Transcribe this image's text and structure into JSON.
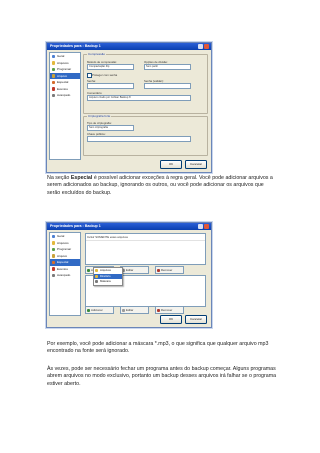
{
  "dialog1": {
    "title": "Propriedades para : Backup 1",
    "sidebar": [
      "Geral",
      "Arquivos",
      "Programar",
      "Arquivo comprimido",
      "Especial",
      "Eventos",
      "Avançado"
    ],
    "group_compress": "Compressão",
    "method_label": "Método de compressão:",
    "method_value": "Compactação Zip",
    "split_label": "Opções de divisão:",
    "split_value": "Sem partir",
    "protect_label": "Proteger com senha",
    "password_label": "Senha:",
    "password_confirm_label": "Senha (validar):",
    "comment_label": "Comentário:",
    "comment_value": "Arquivo criado por Cobian Backup 8",
    "group_crypto": "Criptografia forte",
    "crypto_type_label": "Tipo de criptografia:",
    "crypto_type_value": "Sem criptografia",
    "key_label": "Chave pública:",
    "ok": "OK",
    "cancel": "Cancelar"
  },
  "paragraph1_label": "Na seção ",
  "paragraph1_bold": "Especial",
  "paragraph1_rest": " é possível adicionar exceções à regra geral. Você pode adicionar arquivos a serem adicionados ao backup, ignorando os outros, ou você pode adicionar os arquivos que serão excluídos do backup.",
  "dialog2": {
    "title": "Propriedades para : Backup 1",
    "sidebar": [
      "Geral",
      "Arquivos",
      "Programar",
      "Arquivo comprimido",
      "Especial",
      "Eventos",
      "Avançado"
    ],
    "list_header": "Incluir SOMENTE estes arquivos",
    "add": "Adicionar",
    "edit": "Editar",
    "remove": "Remover",
    "add2": "Adicionar",
    "edit2": "Editar",
    "remove2": "Remover",
    "popup": [
      "Arquivos",
      "Diretório",
      "Máscara"
    ],
    "ok": "OK",
    "cancel": "Cancelar"
  },
  "paragraph2": "Por exemplo, você pode adicionar a máscara *.mp3, o que significa que qualquer arquivo mp3 encontrado na fonte será ignorado.",
  "paragraph3": "Às vezes, pode ser necessário fechar um programa antes do backup começar. Alguns programas abrem arquivos no modo exclusivo, portanto um backup desses arquivos irá falhar se o programa estiver aberto.",
  "colors": {
    "titlebar": "#0a3fb0",
    "selection": "#316ac5",
    "window": "#ece9d8"
  },
  "icons": [
    "house-icon",
    "folder-icon",
    "calendar-icon",
    "archive-icon",
    "star-icon",
    "flag-icon",
    "gear-icon"
  ]
}
